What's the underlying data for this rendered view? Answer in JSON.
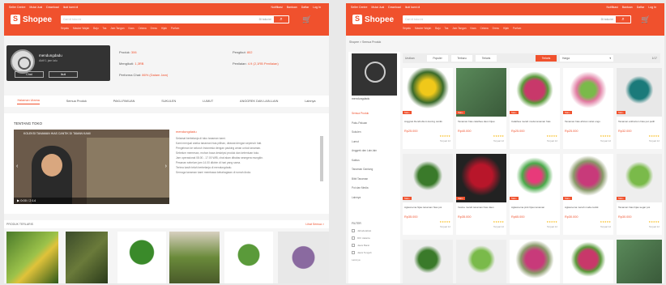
{
  "left": {
    "topbar": {
      "left_items": [
        "Seller Centre",
        "Mulai Jual",
        "Download",
        "Ikuti kami di"
      ],
      "right_items": [
        "Notifikasi",
        "Bantuan",
        "Daftar",
        "Log In"
      ]
    },
    "logo": "Shopee",
    "search": {
      "placeholder": "Cari di toko ini",
      "scope": "Di toko ini"
    },
    "keywords": [
      "Sepatu",
      "Masker Wajah",
      "Baju",
      "Tas",
      "Jam Tangan",
      "Kaos",
      "Celana",
      "Dress",
      "Hijab",
      "Parfum"
    ],
    "shop": {
      "name": "mendungdadu",
      "subtitle": "Aktif 1 jam lalu",
      "chat_label": "Chat",
      "follow_label": "Ikuti"
    },
    "stats": {
      "produk_label": "Produk:",
      "produk": "306",
      "mengikuti_label": "Mengikuti:",
      "mengikuti": "1,3RB",
      "performa_label": "Performa Chat:",
      "performa": "86% (Dalam Jam)",
      "pengikut_label": "Pengikut:",
      "pengikut": "802",
      "penilaian_label": "Penilaian:",
      "penilaian": "4.9 (2,1RB Penilaian)"
    },
    "tabs": [
      "Halaman Utama",
      "Semua Produk",
      "PAKU-PAKUAN",
      "SUKULEN",
      "LUMUT",
      "ANGGREK DAN LAIN-LAIN",
      "Lainnya"
    ],
    "about": {
      "title": "TENTANG TOKO",
      "video_title": "KOLEKSI TANAMAN HIAS CANTIK DI TAMAN KAMI",
      "video_controls": "▶  0:00 / 2:14",
      "heading": "mendungdadu",
      "lines": [
        "Selamat berbelanja di toko tanaman kami.",
        "Kami menjual aneka tanaman hias pilihan, dirawat dengan sepenuh hati.",
        "Pengiriman ke seluruh Indonesia dengan packing aman untuk tanaman.",
        "Sebelum memesan, mohon baca deskripsi produk dan ketentuan toko.",
        "Jam operasional 08.00 - 17.00 WIB, chat akan dibalas sesegera mungkin.",
        "Pesanan sebelum jam 14.00 dikirim di hari yang sama.",
        "Terima kasih telah berbelanja di mendungdadu.",
        "Semoga tanaman kami membawa kebahagiaan di rumah Anda."
      ]
    },
    "section": {
      "title": "PRODUK TERLARIS",
      "see_all": "Lihat Semua >"
    }
  },
  "right": {
    "crumb": "Shopee > Semua Produk",
    "shop_name": "mendungdadu",
    "categories": [
      "Semua Produk",
      "Paku-Pakuan",
      "Sukulen",
      "Lumut",
      "Anggrek dan Lain-lain",
      "Kaktus",
      "Tanaman Gantung",
      "Bibit Tanaman",
      "Pot dan Media",
      "Lainnya"
    ],
    "filter": {
      "title": "FILTER",
      "options": [
        "Jabodetabek",
        "DKI Jakarta",
        "Jawa Barat",
        "Jawa Tengah",
        "Lainnya"
      ]
    },
    "sort": {
      "label": "Urutkan",
      "buttons": [
        "Populer",
        "Terbaru",
        "Terlaris",
        "Terlaris",
        "Harga"
      ],
      "select": "Harga",
      "page": "1/17"
    },
    "products": [
      {
        "name": "Anggrek Dendrobium kuning cantik",
        "price": "Rp25.000",
        "badge": "Star+"
      },
      {
        "name": "Tanaman hias calathea daun hijau",
        "price": "Rp40.000",
        "badge": "Star+"
      },
      {
        "name": "Calathea merah muda tanaman hias",
        "price": "Rp25.000",
        "badge": "Star+"
      },
      {
        "name": "Tanaman hias african violet ungu",
        "price": "Rp25.000",
        "badge": "Star+"
      },
      {
        "name": "Tanaman anthurium hias pot putih",
        "price": "Rp32.000",
        "badge": "Star+"
      },
      {
        "name": "Aglaonema hijau tanaman hias pot",
        "price": "Rp35.000",
        "badge": "Star+"
      },
      {
        "name": "Iresine merah tanaman hias daun",
        "price": "Rp35.000",
        "badge": "Star+"
      },
      {
        "name": "Aglaonema pink hijau tanaman",
        "price": "Rp65.000",
        "badge": "Star+"
      },
      {
        "name": "Aglaonema merah muda cantik",
        "price": "Rp30.000",
        "badge": "Star+"
      },
      {
        "name": "Tanaman hias hijau segar pot",
        "price": "Rp30.000",
        "badge": "Star+"
      }
    ],
    "star_text": "★★★★★",
    "sold_text": "Terjual 12"
  }
}
